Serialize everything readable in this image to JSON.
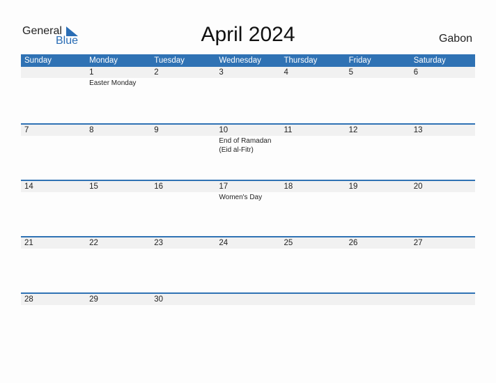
{
  "logo": {
    "line1": "General",
    "line2": "Blue"
  },
  "title": "April 2024",
  "country": "Gabon",
  "colors": {
    "accent": "#2f72b4",
    "band": "#f1f1f1"
  },
  "weekdays": [
    "Sunday",
    "Monday",
    "Tuesday",
    "Wednesday",
    "Thursday",
    "Friday",
    "Saturday"
  ],
  "weeks": [
    [
      {
        "day": ""
      },
      {
        "day": "1",
        "event": "Easter Monday"
      },
      {
        "day": "2"
      },
      {
        "day": "3"
      },
      {
        "day": "4"
      },
      {
        "day": "5"
      },
      {
        "day": "6"
      }
    ],
    [
      {
        "day": "7"
      },
      {
        "day": "8"
      },
      {
        "day": "9"
      },
      {
        "day": "10",
        "event": "End of Ramadan (Eid al-Fitr)"
      },
      {
        "day": "11"
      },
      {
        "day": "12"
      },
      {
        "day": "13"
      }
    ],
    [
      {
        "day": "14"
      },
      {
        "day": "15"
      },
      {
        "day": "16"
      },
      {
        "day": "17",
        "event": "Women's Day"
      },
      {
        "day": "18"
      },
      {
        "day": "19"
      },
      {
        "day": "20"
      }
    ],
    [
      {
        "day": "21"
      },
      {
        "day": "22"
      },
      {
        "day": "23"
      },
      {
        "day": "24"
      },
      {
        "day": "25"
      },
      {
        "day": "26"
      },
      {
        "day": "27"
      }
    ],
    [
      {
        "day": "28"
      },
      {
        "day": "29"
      },
      {
        "day": "30"
      },
      {
        "day": ""
      },
      {
        "day": ""
      },
      {
        "day": ""
      },
      {
        "day": ""
      }
    ]
  ]
}
